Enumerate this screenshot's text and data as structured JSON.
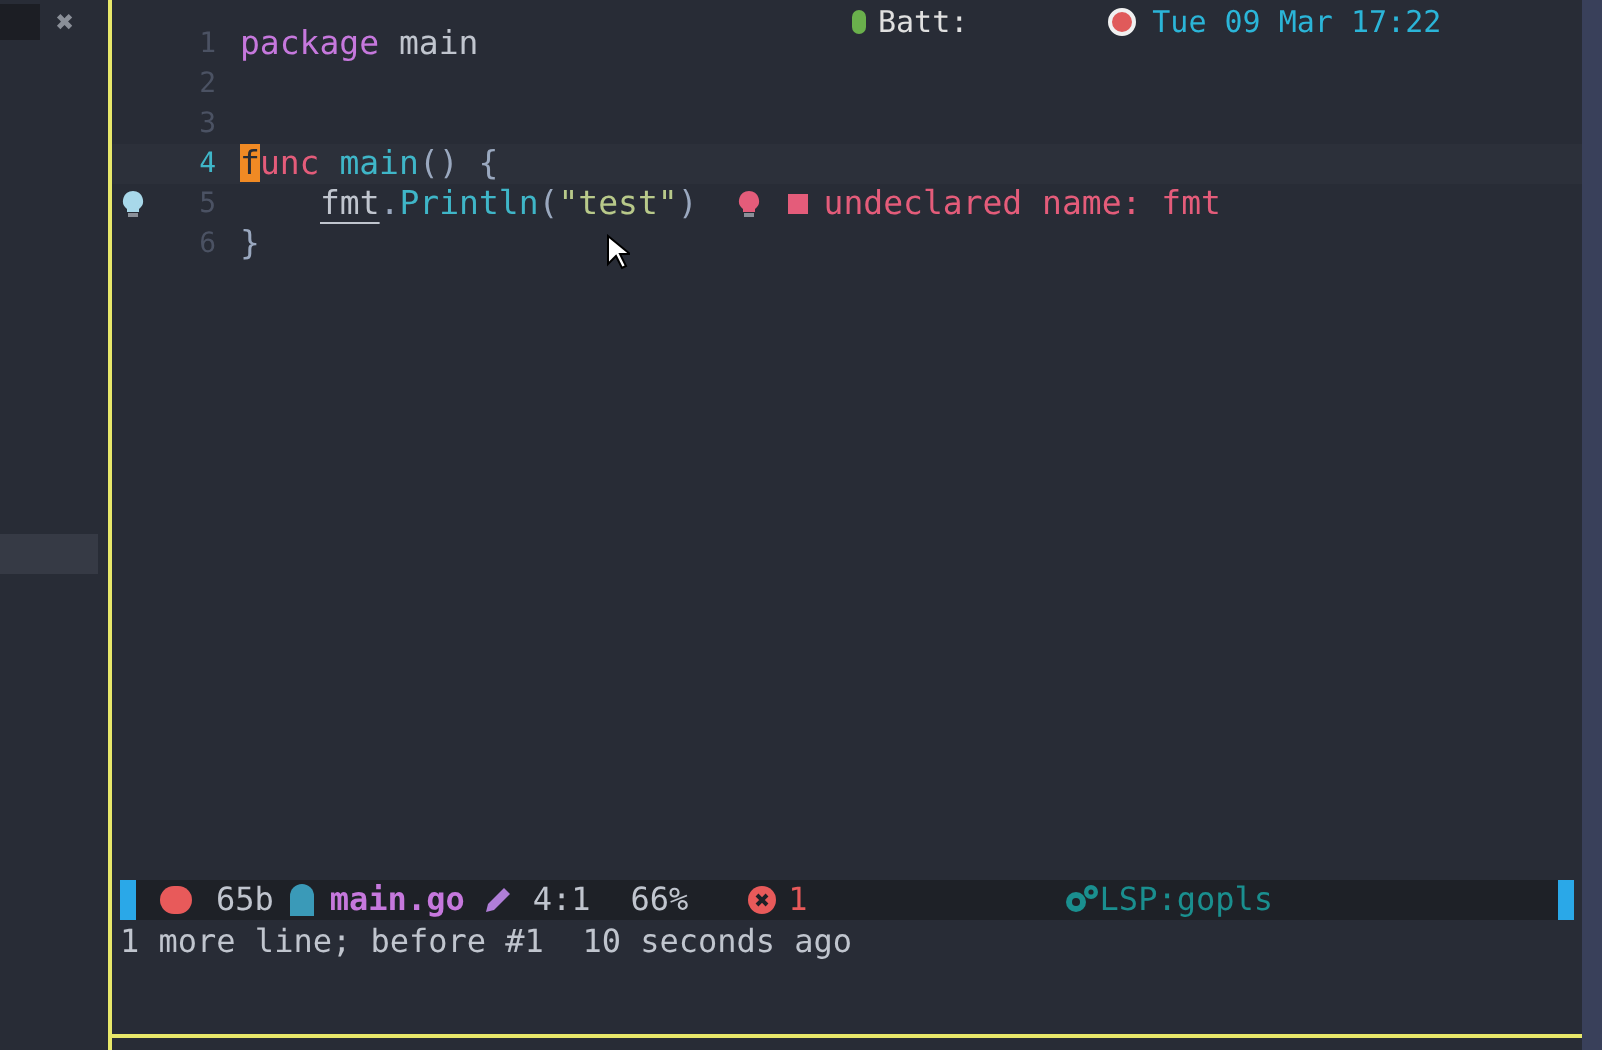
{
  "top_bar": {
    "items": [
      {
        "kind": "battery",
        "text": "Batt:"
      },
      {
        "kind": "clock",
        "text": "Tue 09 Mar 17:22"
      }
    ]
  },
  "sidebar": {
    "close": "✖"
  },
  "editor": {
    "lines": [
      {
        "number": "1",
        "current": false,
        "hint": false,
        "tokens": [
          {
            "kind": "keyword",
            "text": "package"
          },
          {
            "kind": "plain",
            "text": " main"
          }
        ]
      },
      {
        "number": "2",
        "current": false,
        "hint": false
      },
      {
        "number": "3",
        "current": false,
        "hint": false
      },
      {
        "number": "4",
        "current": true,
        "hint": false,
        "tokens": [
          {
            "kind": "cursor",
            "text": "f"
          },
          {
            "kind": "decl",
            "text": "unc "
          },
          {
            "kind": "function",
            "text": "main"
          },
          {
            "kind": "punct",
            "text": "() {"
          }
        ]
      },
      {
        "number": "5",
        "current": false,
        "hint": true,
        "indented": true,
        "tokens": [
          {
            "kind": "error",
            "text": "fmt"
          },
          {
            "kind": "punct",
            "text": "."
          },
          {
            "kind": "function",
            "text": "Println"
          },
          {
            "kind": "punct",
            "text": "("
          },
          {
            "kind": "string",
            "text": "\"test\""
          },
          {
            "kind": "punct",
            "text": ")"
          }
        ],
        "diagnostic": "undeclared name: fmt"
      },
      {
        "number": "6",
        "current": false,
        "hint": false,
        "tokens": [
          {
            "kind": "punct",
            "text": "}"
          }
        ]
      }
    ]
  },
  "status_bar": {
    "size": "65b",
    "file": "main.go",
    "position": "4:1",
    "percent": "66%",
    "errors": "1",
    "lsp": "LSP:gopls"
  },
  "message": "1 more line; before #1  10 seconds ago"
}
